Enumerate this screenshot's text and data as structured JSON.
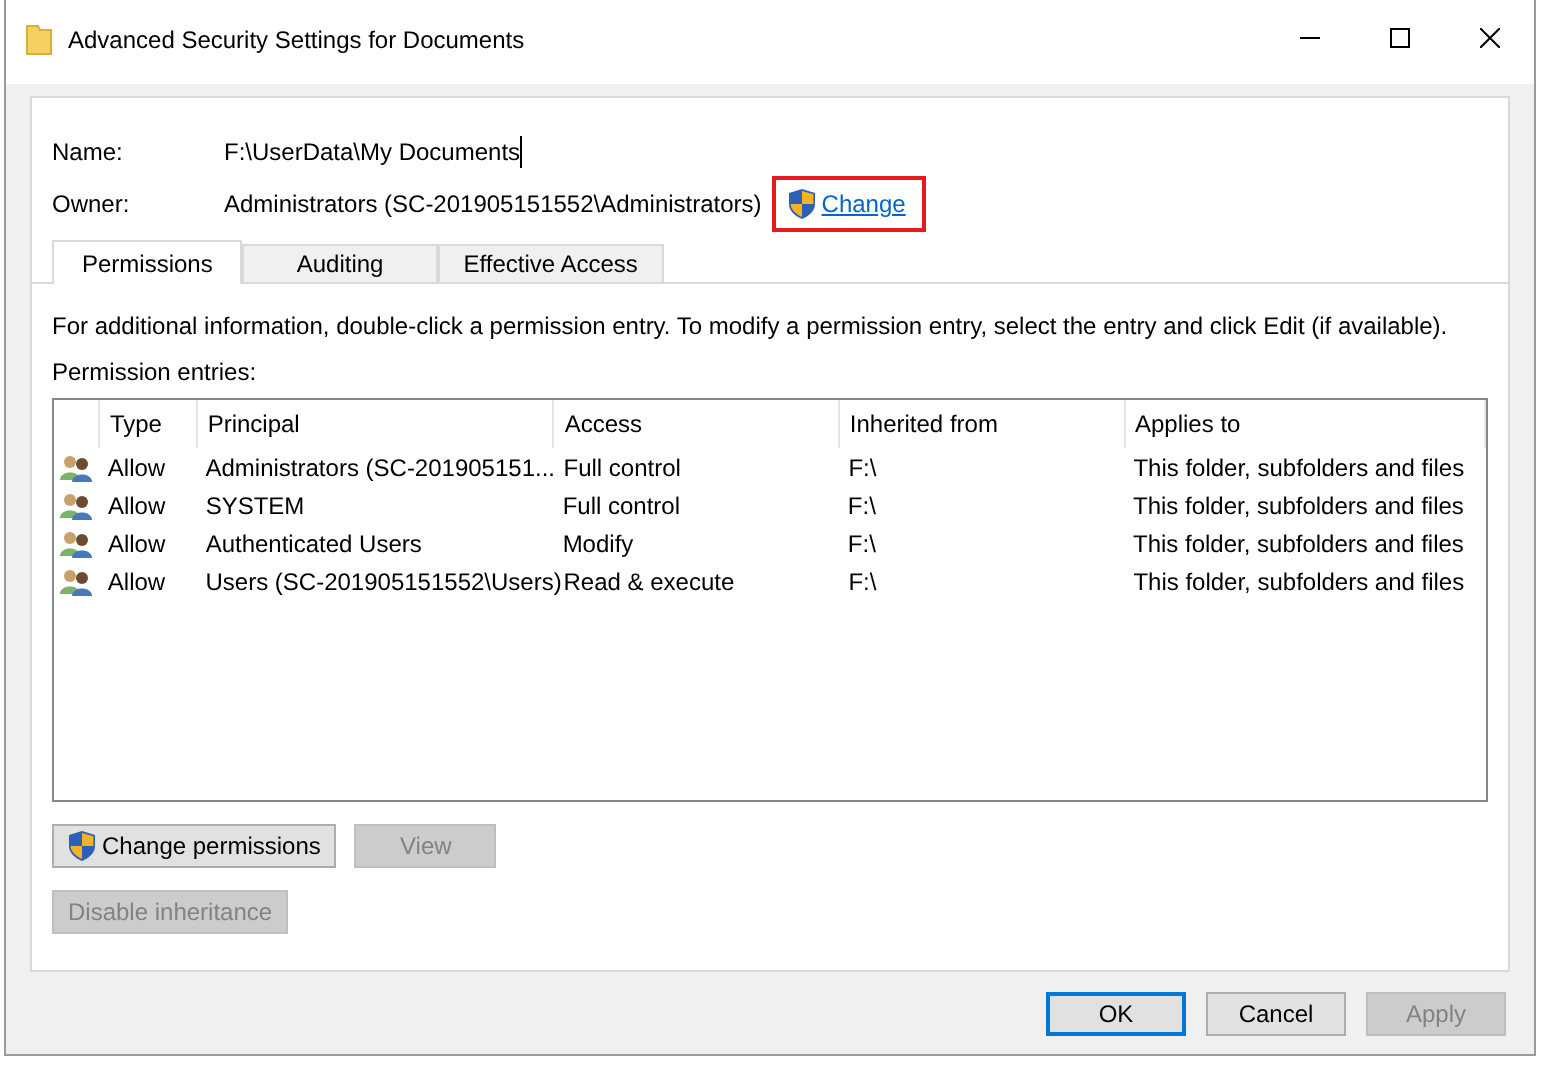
{
  "window": {
    "title": "Advanced Security Settings for Documents"
  },
  "name": {
    "label": "Name:",
    "value": "F:\\UserData\\My Documents"
  },
  "owner": {
    "label": "Owner:",
    "value": "Administrators (SC-201905151552\\Administrators)",
    "change_link": {
      "label": "Change",
      "highlighted": true
    }
  },
  "tabs": [
    {
      "label": "Permissions",
      "selected": true
    },
    {
      "label": "Auditing",
      "selected": false
    },
    {
      "label": "Effective Access",
      "selected": false
    }
  ],
  "info_text": "For additional information, double-click a permission entry. To modify a permission entry, select the entry and click Edit (if available).",
  "entries_label": "Permission entries:",
  "table": {
    "columns": [
      "Type",
      "Principal",
      "Access",
      "Inherited from",
      "Applies to"
    ],
    "rows": [
      {
        "type": "Allow",
        "principal": "Administrators (SC-201905151...",
        "access": "Full control",
        "inherited_from": "F:\\",
        "applies_to": "This folder, subfolders and files"
      },
      {
        "type": "Allow",
        "principal": "SYSTEM",
        "access": "Full control",
        "inherited_from": "F:\\",
        "applies_to": "This folder, subfolders and files"
      },
      {
        "type": "Allow",
        "principal": "Authenticated Users",
        "access": "Modify",
        "inherited_from": "F:\\",
        "applies_to": "This folder, subfolders and files"
      },
      {
        "type": "Allow",
        "principal": "Users (SC-201905151552\\Users)",
        "access": "Read & execute",
        "inherited_from": "F:\\",
        "applies_to": "This folder, subfolders and files"
      }
    ]
  },
  "actions": [
    {
      "label": "Change permissions",
      "shield": true,
      "disabled": false
    },
    {
      "label": "View",
      "shield": false,
      "disabled": true
    }
  ],
  "inheritance_button": {
    "label": "Disable inheritance",
    "disabled": true
  },
  "footer_buttons": [
    {
      "label": "OK",
      "default": true,
      "disabled": false
    },
    {
      "label": "Cancel",
      "default": false,
      "disabled": false
    },
    {
      "label": "Apply",
      "default": false,
      "disabled": true
    }
  ]
}
